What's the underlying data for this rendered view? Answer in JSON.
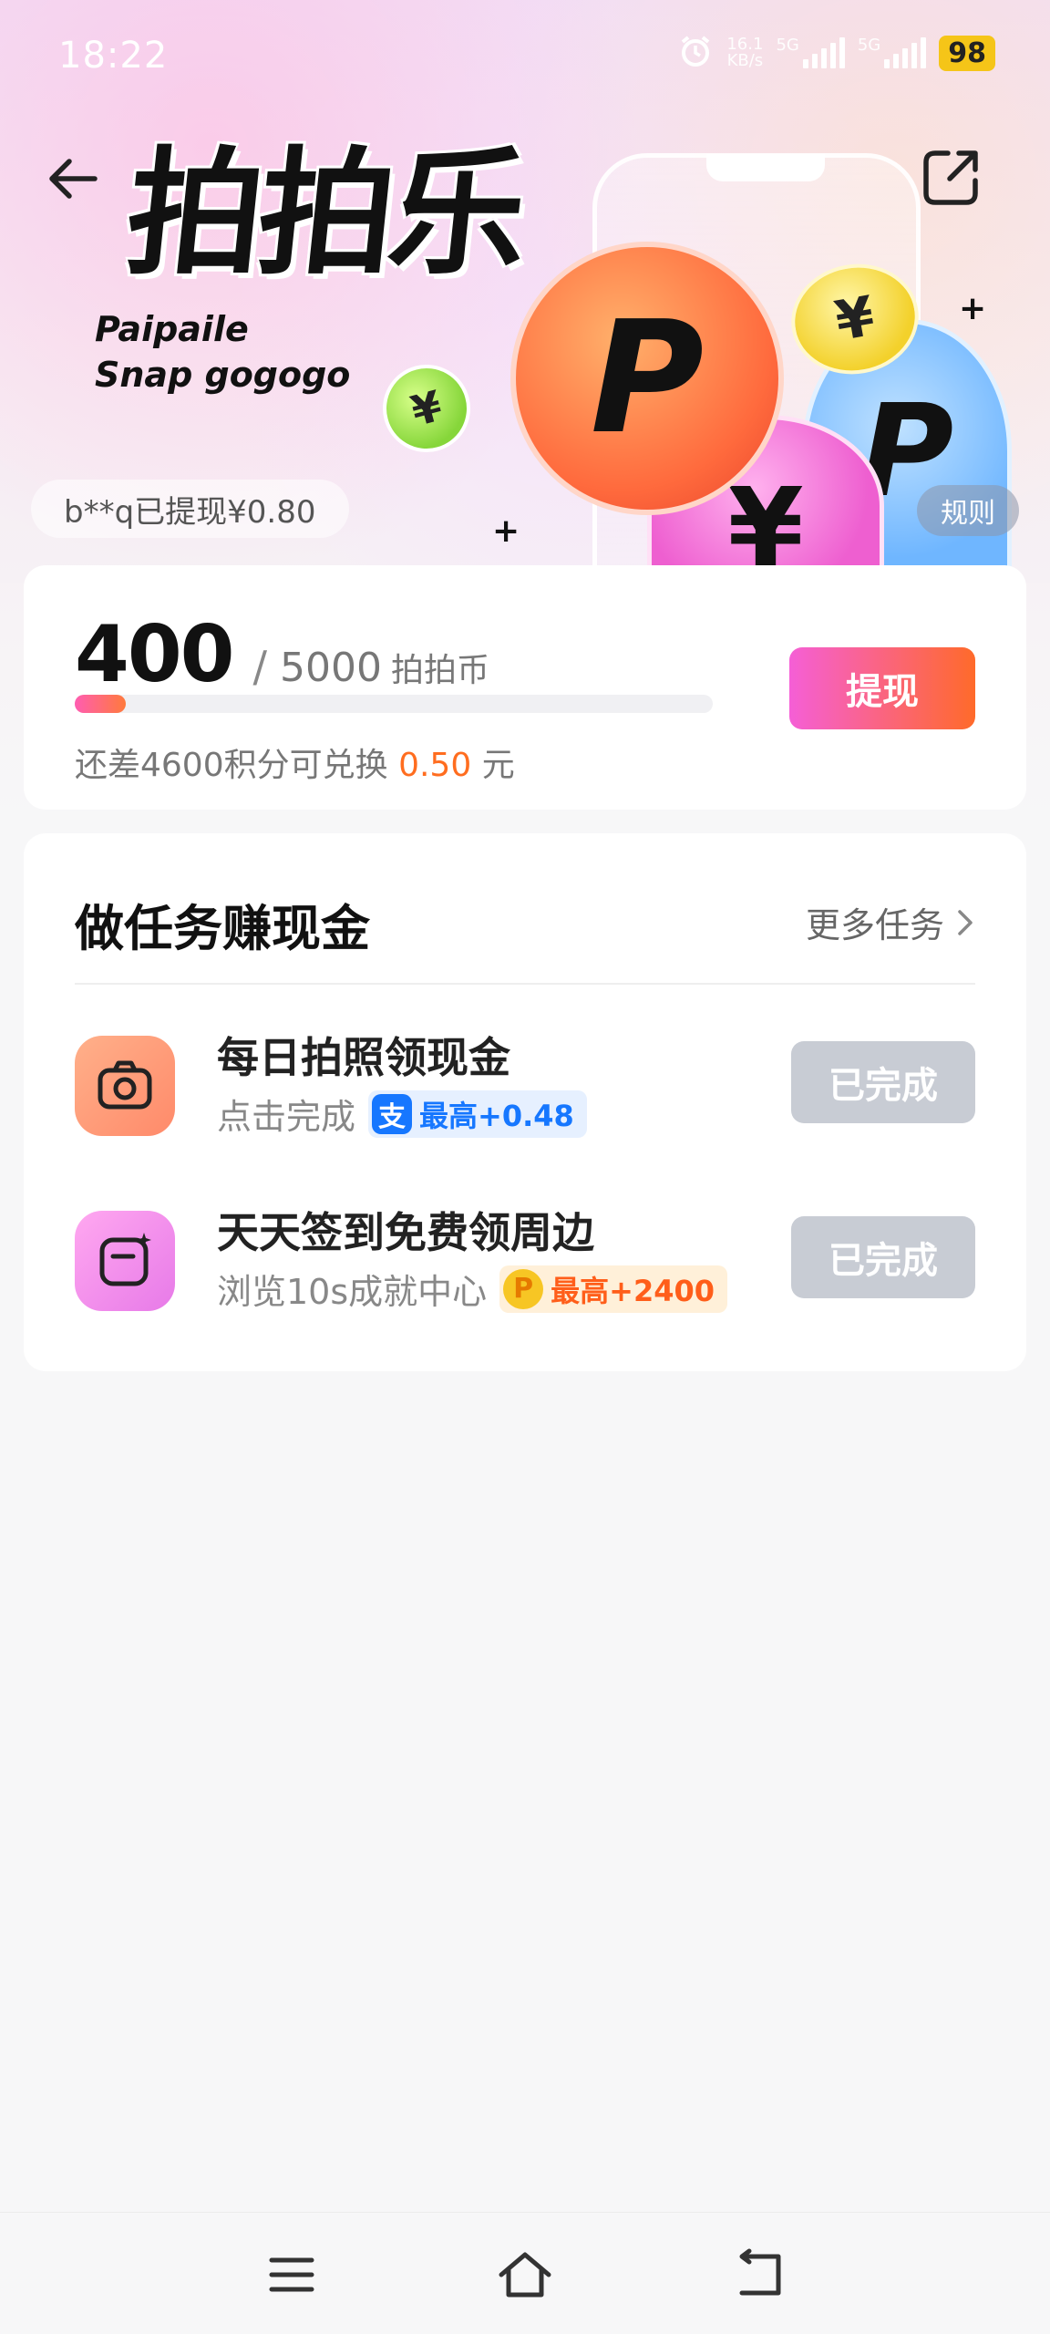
{
  "status_bar": {
    "time": "18:22",
    "net_speed_value": "16.1",
    "net_speed_unit": "KB/s",
    "signal1_label": "5G",
    "signal2_label": "5G",
    "battery": "98"
  },
  "header": {
    "logo_title": "拍拍乐",
    "logo_subtitle_line1": "Paipaile",
    "logo_subtitle_line2": "Snap gogogo",
    "withdraw_toast": "b**q已提现¥0.80",
    "rules_label": "规则"
  },
  "balance": {
    "current": "400",
    "separator": "/",
    "total": "5000",
    "unit": "拍拍币",
    "progress_fraction": 0.08,
    "hint_prefix": "还差4600积分可兑换",
    "hint_amount": "0.50",
    "hint_suffix": "元",
    "cashout_label": "提现"
  },
  "tasks": {
    "title": "做任务赚现金",
    "more_label": "更多任务",
    "items": [
      {
        "name": "每日拍照领现金",
        "subtitle": "点击完成",
        "reward_badge": "支",
        "reward": "最高+0.48",
        "button": "已完成"
      },
      {
        "name": "天天签到免费领周边",
        "subtitle": "浏览10s成就中心",
        "reward_badge": "P",
        "reward": "最高+2400",
        "button": "已完成"
      }
    ]
  },
  "colors": {
    "accent_gradient_start": "#f55fd6",
    "accent_gradient_end": "#ff6a2a",
    "amount_orange": "#ff6d1f",
    "done_gray": "#c8ccd4",
    "alipay_blue": "#1677ff"
  },
  "icons": {
    "back": "arrow-left-icon",
    "share": "share-external-icon",
    "camera": "camera-icon",
    "checkin": "checkin-sparkle-icon",
    "nav_menu": "menu-icon",
    "nav_home": "home-icon",
    "nav_back": "back-icon"
  }
}
